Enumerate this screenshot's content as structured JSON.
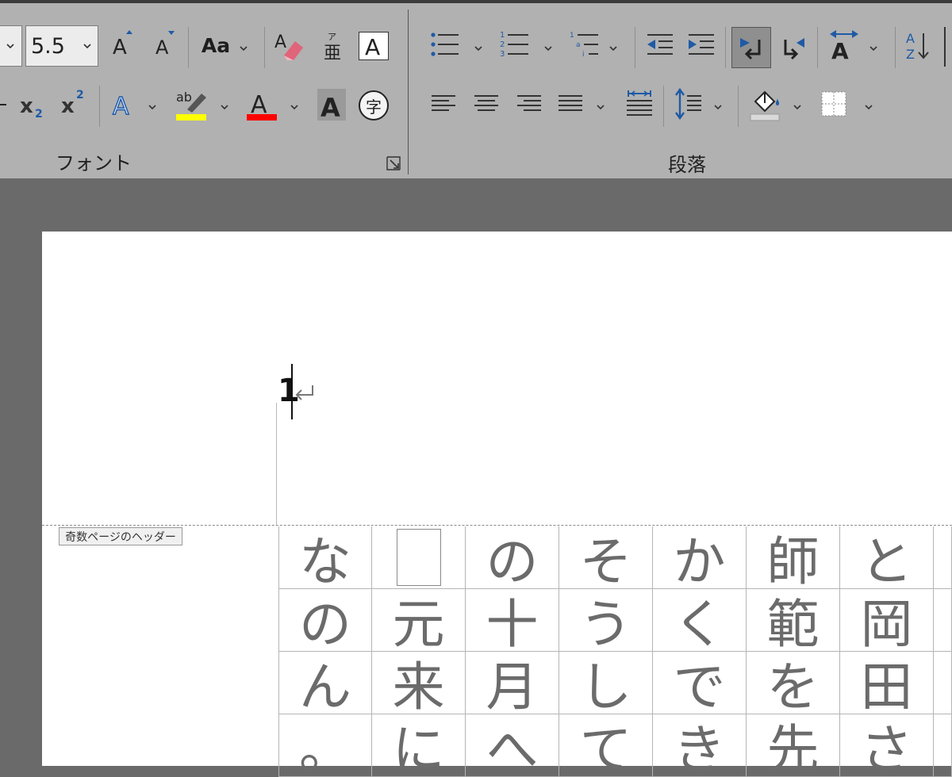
{
  "ribbon": {
    "font_size": "5.5",
    "change_case_label": "Aa",
    "enclose_char": "字",
    "group_font": "フォント",
    "group_paragraph": "段落"
  },
  "colors": {
    "highlight": "#ffff00",
    "font_color": "#ff0000",
    "ribbon_bg": "#b1b1b1",
    "accent_blue": "#1f5aa6"
  },
  "document": {
    "page_number": "1",
    "header_tag": "奇数ページのヘッダー",
    "columns": [
      [
        "な",
        "の",
        "ん",
        "。"
      ],
      [
        "□",
        "元",
        "来",
        "に"
      ],
      [
        "の",
        "十",
        "月",
        "へ"
      ],
      [
        "そ",
        "う",
        "し",
        "て"
      ],
      [
        "か",
        "く",
        "で",
        "き"
      ],
      [
        "師",
        "範",
        "を",
        "先"
      ],
      [
        "と",
        "岡",
        "田",
        "さ"
      ]
    ]
  }
}
